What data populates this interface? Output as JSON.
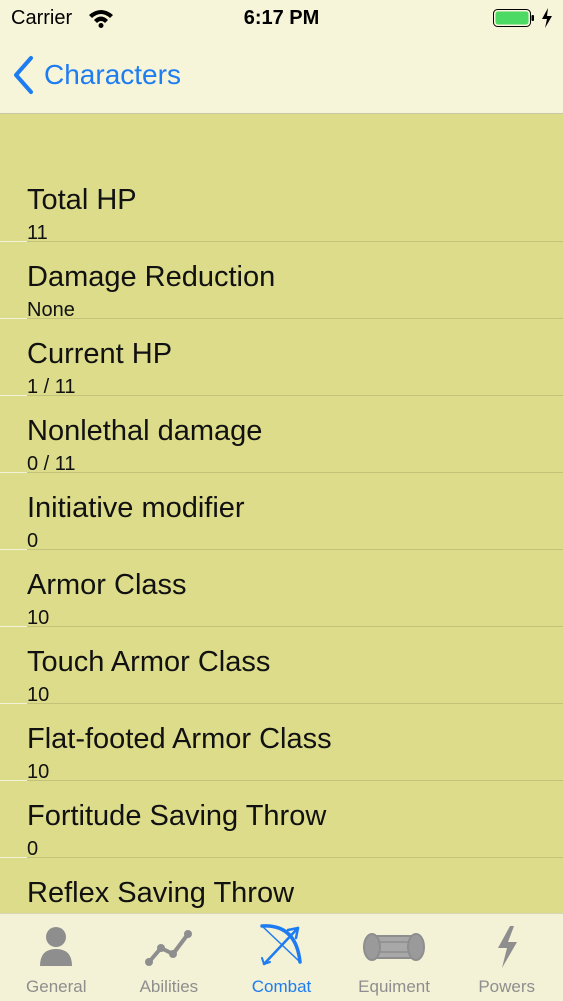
{
  "status_bar": {
    "carrier": "Carrier",
    "time": "6:17 PM"
  },
  "nav": {
    "back_label": "Characters"
  },
  "rows": [
    {
      "title": "Total HP",
      "value": "11"
    },
    {
      "title": "Damage Reduction",
      "value": "None"
    },
    {
      "title": "Current HP",
      "value": "1 / 11"
    },
    {
      "title": "Nonlethal damage",
      "value": "0 / 11"
    },
    {
      "title": "Initiative modifier",
      "value": "0"
    },
    {
      "title": "Armor Class",
      "value": "10"
    },
    {
      "title": "Touch Armor Class",
      "value": "10"
    },
    {
      "title": "Flat-footed Armor Class",
      "value": "10"
    },
    {
      "title": "Fortitude Saving Throw",
      "value": "0"
    },
    {
      "title": "Reflex Saving Throw",
      "value": ""
    }
  ],
  "tabs": [
    {
      "label": "General",
      "icon": "person-icon"
    },
    {
      "label": "Abilities",
      "icon": "chart-line-icon"
    },
    {
      "label": "Combat",
      "icon": "bow-arrow-icon",
      "active": true
    },
    {
      "label": "Equiment",
      "icon": "scroll-icon"
    },
    {
      "label": "Powers",
      "icon": "lightning-icon"
    }
  ],
  "colors": {
    "accent": "#1e7cf2",
    "background": "#dcdc8a",
    "bars": "#f6f4d9",
    "battery": "#4cd964"
  }
}
